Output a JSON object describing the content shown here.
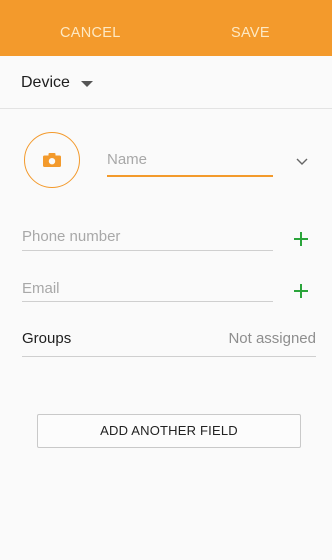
{
  "header": {
    "cancel_label": "CANCEL",
    "save_label": "SAVE",
    "accent_color": "#f39a2c"
  },
  "storage": {
    "label": "Device",
    "icon": "dropdown-caret-icon"
  },
  "photo": {
    "icon": "camera-icon"
  },
  "fields": {
    "name_placeholder": "Name",
    "phone_placeholder": "Phone number",
    "email_placeholder": "Email",
    "expand_icon": "chevron-down-icon",
    "add_icon": "plus-icon",
    "add_icon_color": "#2aa43a"
  },
  "groups": {
    "label": "Groups",
    "value": "Not assigned"
  },
  "add_field_button": {
    "label": "ADD ANOTHER FIELD"
  }
}
